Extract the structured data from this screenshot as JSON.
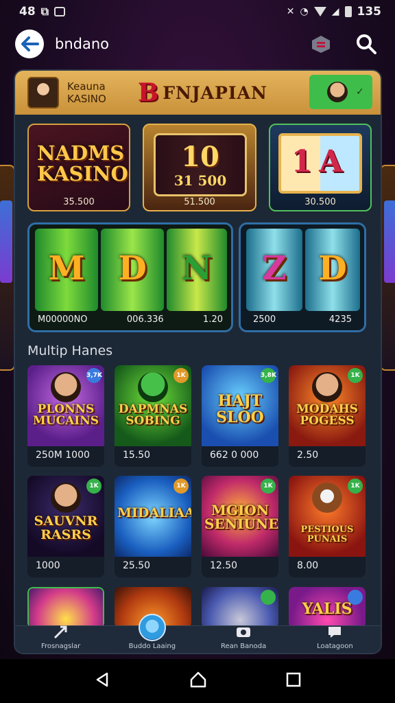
{
  "status_bar": {
    "left_time": "48",
    "right_text": "135"
  },
  "app_bar": {
    "title": "bndano",
    "icons": [
      "back-arrow-icon",
      "stack-icon",
      "search-icon"
    ]
  },
  "header": {
    "brand_line1": "Keauna",
    "brand_line2": "KASINO",
    "logo_mark": "B",
    "logo_text": "FNJAPIAN"
  },
  "featured": [
    {
      "title": "NADMS KASINO",
      "label": "35.500"
    },
    {
      "big": "10",
      "small": "31 500",
      "label": "51.500"
    },
    {
      "symbols": "1A",
      "label": "30.500"
    }
  ],
  "big_reels": [
    {
      "symbols": [
        "M",
        "D",
        "N"
      ],
      "labels": [
        "M00000NO",
        "006.336",
        "1.20"
      ]
    },
    {
      "symbols": [
        "Z",
        "D"
      ],
      "labels": [
        "2500",
        "4235"
      ]
    }
  ],
  "section_title": "Multip Hanes",
  "tiles": [
    {
      "name": "PLONNS MUCAINS",
      "price": "250M 1000",
      "badge": "3,7K"
    },
    {
      "name": "DAPMNAS SOBING",
      "price": "15.50",
      "badge": "1K"
    },
    {
      "name": "HAJT SLOO",
      "price": "662 0 000",
      "badge": "3,8K"
    },
    {
      "name": "MODAHS POGESS",
      "price": "2.50",
      "badge": "1K"
    },
    {
      "name": "SAUVNR RASRS",
      "price": "1000",
      "badge": "1K"
    },
    {
      "name": "MIDALIAA",
      "price": "25.50",
      "badge": "1K"
    },
    {
      "name": "MGION SENIUNES",
      "price": "12.50",
      "badge": "1K"
    },
    {
      "name": "PESTIOUS PUNAIS",
      "price": "8.00",
      "badge": "1K"
    },
    {
      "name": "",
      "price": "",
      "badge": ""
    },
    {
      "name": "",
      "price": "",
      "badge": ""
    },
    {
      "name": "",
      "price": "",
      "badge": ""
    },
    {
      "name": "YALIS",
      "price": "",
      "badge": ""
    }
  ],
  "tabs": [
    {
      "label": "Frosnagslar",
      "icon": "star-arrow-icon"
    },
    {
      "label": "Buddo Laaing",
      "icon": "coin-icon"
    },
    {
      "label": "Rean Banoda",
      "icon": "camera-icon"
    },
    {
      "label": "Loatagoon",
      "icon": "chat-icon"
    }
  ],
  "colors": {
    "background": "#1c0b24",
    "panel": "#1d2836",
    "header_gold": "#e4b45c",
    "accent_green": "#3fbd4b",
    "title_gold": "#ffcf4a"
  }
}
